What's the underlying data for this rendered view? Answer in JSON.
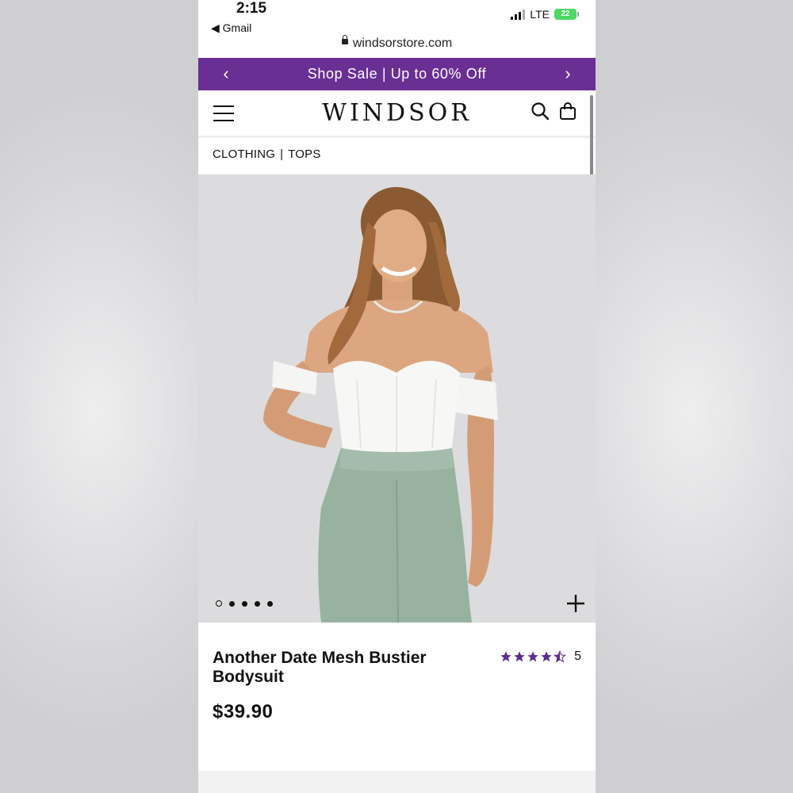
{
  "status_bar": {
    "time": "2:15",
    "back_app": "◀ Gmail",
    "network": "LTE",
    "battery": "22"
  },
  "browser": {
    "url": "windsorstore.com"
  },
  "promo_banner": {
    "text": "Shop Sale | Up to 60% Off",
    "prev_icon": "chevron-left-icon",
    "next_icon": "chevron-right-icon"
  },
  "header": {
    "logo": "WINDSOR",
    "menu_icon": "hamburger-menu-icon",
    "search_icon": "search-icon",
    "bag_icon": "shopping-bag-icon"
  },
  "breadcrumb": [
    "CLOTHING",
    "|",
    "TOPS"
  ],
  "gallery": {
    "image_count": 5,
    "active_index": 0,
    "zoom_icon": "plus-icon"
  },
  "product": {
    "title": "Another Date Mesh Bustier Bodysuit",
    "price": "$39.90",
    "rating": 4.5,
    "review_count": "5"
  },
  "colors": {
    "brand_purple": "#6a2f93",
    "star_purple": "#5b2d8e",
    "pants_green": "#98b2a0",
    "top_white": "#f7f7f5"
  }
}
